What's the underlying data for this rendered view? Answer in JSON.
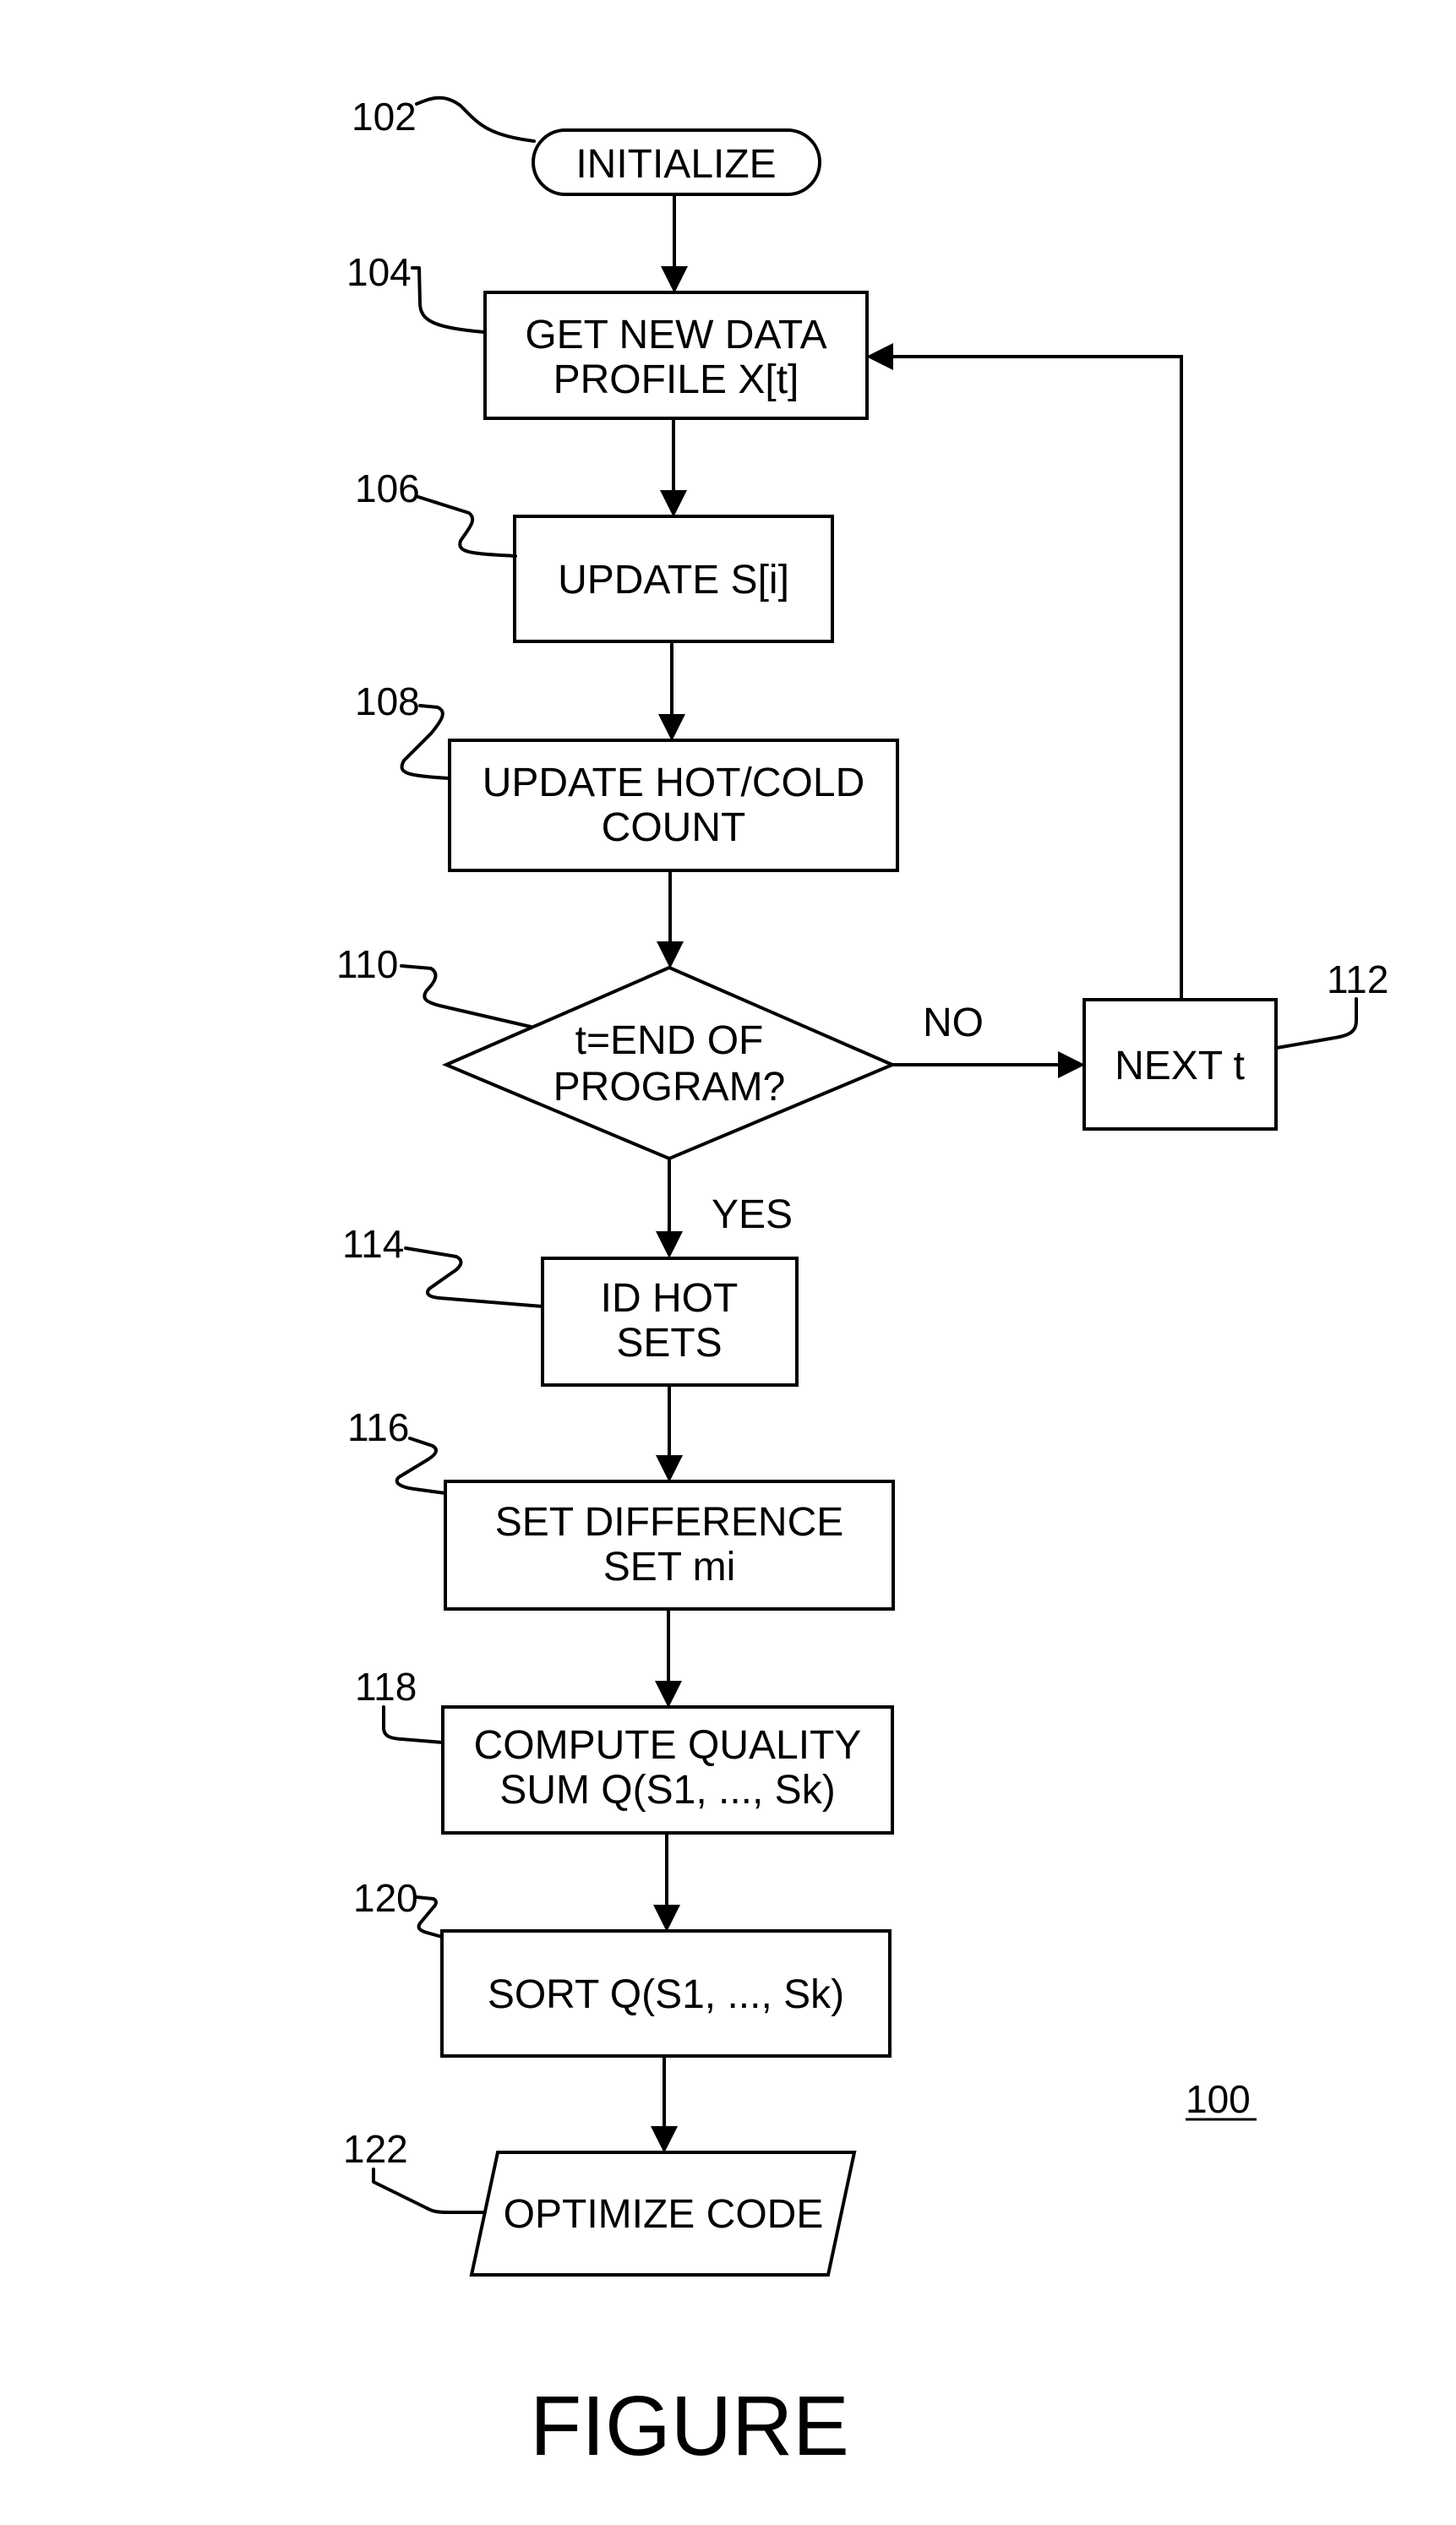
{
  "figure": {
    "reference": "100",
    "caption": "FIGURE"
  },
  "nodes": {
    "initialize": {
      "ref": "102",
      "shape": "terminator",
      "lines": [
        "INITIALIZE"
      ]
    },
    "get_profile": {
      "ref": "104",
      "shape": "process",
      "lines": [
        "GET NEW DATA",
        "PROFILE X[t]"
      ]
    },
    "update_s": {
      "ref": "106",
      "shape": "process",
      "lines": [
        "UPDATE S[i]"
      ]
    },
    "update_hot_cold": {
      "ref": "108",
      "shape": "process",
      "lines": [
        "UPDATE HOT/COLD",
        "COUNT"
      ]
    },
    "end_check": {
      "ref": "110",
      "shape": "decision",
      "lines": [
        "t=END OF",
        "PROGRAM?"
      ]
    },
    "next_t": {
      "ref": "112",
      "shape": "process",
      "lines": [
        "NEXT t"
      ]
    },
    "id_hot_sets": {
      "ref": "114",
      "shape": "process",
      "lines": [
        "ID HOT",
        "SETS"
      ]
    },
    "set_difference": {
      "ref": "116",
      "shape": "process",
      "lines": [
        "SET DIFFERENCE",
        "SET mi"
      ]
    },
    "compute_quality": {
      "ref": "118",
      "shape": "process",
      "lines": [
        "COMPUTE QUALITY",
        "SUM Q(S1, ..., Sk)"
      ]
    },
    "sort_quality": {
      "ref": "120",
      "shape": "process",
      "lines": [
        "SORT Q(S1, ..., Sk)"
      ]
    },
    "optimize_code": {
      "ref": "122",
      "shape": "io",
      "lines": [
        "OPTIMIZE CODE"
      ]
    }
  },
  "edges": [
    {
      "from": "initialize",
      "to": "get_profile",
      "label": ""
    },
    {
      "from": "get_profile",
      "to": "update_s",
      "label": ""
    },
    {
      "from": "update_s",
      "to": "update_hot_cold",
      "label": ""
    },
    {
      "from": "update_hot_cold",
      "to": "end_check",
      "label": ""
    },
    {
      "from": "end_check",
      "to": "next_t",
      "label": "NO"
    },
    {
      "from": "next_t",
      "to": "get_profile",
      "label": ""
    },
    {
      "from": "end_check",
      "to": "id_hot_sets",
      "label": "YES"
    },
    {
      "from": "id_hot_sets",
      "to": "set_difference",
      "label": ""
    },
    {
      "from": "set_difference",
      "to": "compute_quality",
      "label": ""
    },
    {
      "from": "compute_quality",
      "to": "sort_quality",
      "label": ""
    },
    {
      "from": "sort_quality",
      "to": "optimize_code",
      "label": ""
    }
  ],
  "edge_labels": {
    "no": "NO",
    "yes": "YES"
  }
}
